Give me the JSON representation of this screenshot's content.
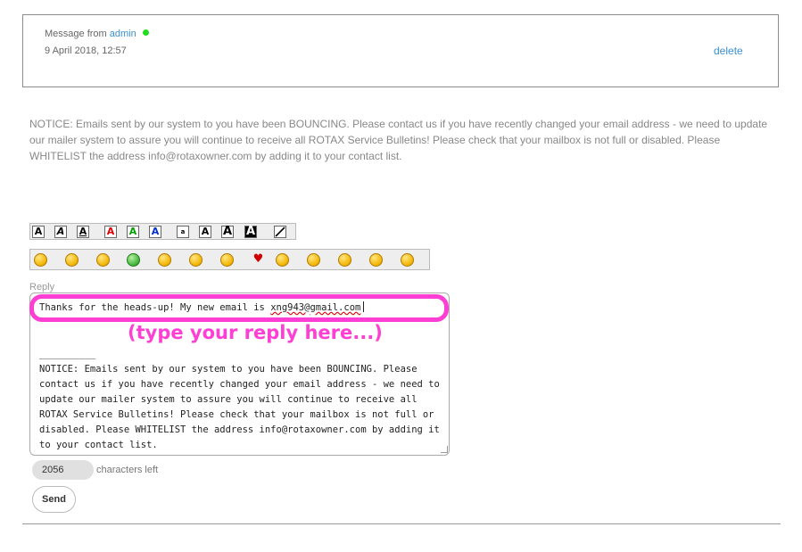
{
  "message": {
    "from_prefix": "Message from",
    "sender": "admin",
    "date": "9 April 2018, 12:57",
    "delete_label": "delete",
    "online_color": "#22dd22"
  },
  "notice": "NOTICE: Emails sent by our system to you have been BOUNCING. Please contact us if you have recently changed your email address - we need to update our mailer system to assure you will continue to receive all ROTAX Service Bulletins! Please check that your mailbox is not full or disabled. Please WHITELIST the address info@rotaxowner.com by adding it to your contact list.",
  "format_toolbar": [
    {
      "icon": "bold-a-icon",
      "glyph": "A",
      "color": "#000000"
    },
    {
      "icon": "italic-a-icon",
      "glyph": "A",
      "color": "#000000"
    },
    {
      "icon": "underline-a-icon",
      "glyph": "A",
      "color": "#000000"
    },
    {
      "icon": "red-text-icon",
      "glyph": "A",
      "color": "#e00000"
    },
    {
      "icon": "green-text-icon",
      "glyph": "A",
      "color": "#00a000"
    },
    {
      "icon": "blue-text-icon",
      "glyph": "A",
      "color": "#0030d0"
    },
    {
      "icon": "tiny-text-icon",
      "glyph": "a",
      "color": "#000000"
    },
    {
      "icon": "small-text-icon",
      "glyph": "A",
      "color": "#000000"
    },
    {
      "icon": "large-text-icon",
      "glyph": "A",
      "color": "#000000"
    },
    {
      "icon": "huge-text-icon",
      "glyph": "A",
      "color": "#000000"
    },
    {
      "icon": "strike-slash-icon",
      "glyph": "",
      "color": "#000000"
    }
  ],
  "emoji_toolbar": [
    {
      "icon": "smile-emoji-icon",
      "face": "•‿•",
      "variant": "yellow"
    },
    {
      "icon": "sad-emoji-icon",
      "face": "•︵•",
      "variant": "yellow"
    },
    {
      "icon": "tongue-emoji-icon",
      "face": "•ᴗ•",
      "variant": "yellow"
    },
    {
      "icon": "sick-emoji-icon",
      "face": "ಠ_ಠ",
      "variant": "green"
    },
    {
      "icon": "angry-emoji-icon",
      "face": "ò_ó",
      "variant": "yellow"
    },
    {
      "icon": "surprised-emoji-icon",
      "face": "•o•",
      "variant": "yellow"
    },
    {
      "icon": "cool-emoji-icon",
      "face": "■_■",
      "variant": "yellow"
    },
    {
      "icon": "heart-icon",
      "face": "♥",
      "variant": "heart"
    },
    {
      "icon": "kiss-emoji-icon",
      "face": "•з•",
      "variant": "yellow"
    },
    {
      "icon": "grin-emoji-icon",
      "face": "^▽^",
      "variant": "yellow"
    },
    {
      "icon": "shock-emoji-icon",
      "face": "°O°",
      "variant": "yellow"
    },
    {
      "icon": "wink-emoji-icon",
      "face": "-‿•",
      "variant": "yellow"
    },
    {
      "icon": "confused-emoji-icon",
      "face": "•?•",
      "variant": "yellow"
    }
  ],
  "reply": {
    "label": "Reply",
    "typed_prefix": "Thanks for the heads-up! My new email is ",
    "typed_email": "xng943@gmail.com",
    "hint_overlay": "(type your reply here...)",
    "separator": "__________",
    "quoted_notice": "NOTICE: Emails sent by our system to you have been BOUNCING. Please contact us if you have recently changed your email address - we need to update our mailer system to assure you will continue to receive all ROTAX Service Bulletins! Please check that your mailbox is not full or disabled. Please WHITELIST the address info@rotaxowner.com by adding it to your contact list."
  },
  "counter": {
    "value": "2056",
    "label": "characters left"
  },
  "send_label": "Send",
  "colors": {
    "accent_link": "#3a8fd0",
    "highlight": "#ff3fd4"
  }
}
